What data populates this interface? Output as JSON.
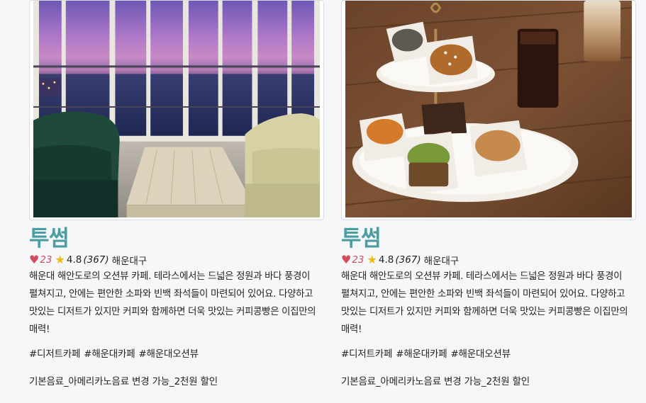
{
  "cards": [
    {
      "title": "투썸",
      "likes": "23",
      "rating": "4.8",
      "reviews": "(367)",
      "district": "해운대구",
      "description": "해운대 해안도로의 오션뷰 카페. 테라스에서는 드넓은 정원과 바다 풍경이 펼쳐지고, 안에는 편안한 소파와 빈백 좌석들이 마련되어 있어요. 다양하고 맛있는 디저트가 있지만 커피와 함께하면 더욱 맛있는 커피콩빵은 이집만의 매력!",
      "tags": [
        "#디저트카페",
        "#해운대카페",
        "#해운대오션뷰"
      ],
      "offer": "기본음료_아메리카노음료 변경 가능_2천원 할인",
      "photo": "ocean-view-interior"
    },
    {
      "title": "투썸",
      "likes": "23",
      "rating": "4.8",
      "reviews": "(367)",
      "district": "해운대구",
      "description": "해운대 해안도로의 오션뷰 카페. 테라스에서는 드넓은 정원과 바다 풍경이 펼쳐지고, 안에는 편안한 소파와 빈백 좌석들이 마련되어 있어요. 다양하고 맛있는 디저트가 있지만 커피와 함께하면 더욱 맛있는 커피콩빵은 이집만의 매력!",
      "tags": [
        "#디저트카페",
        "#해운대카페",
        "#해운대오션뷰"
      ],
      "offer": "기본음료_아메리카노음료 변경 가능_2천원 할인",
      "photo": "dessert-stand"
    }
  ],
  "colors": {
    "title": "#4a9ea3",
    "heart": "#d64b5a",
    "star": "#f2b705"
  },
  "icons": {
    "like": "heart-icon",
    "rating": "star-icon"
  }
}
